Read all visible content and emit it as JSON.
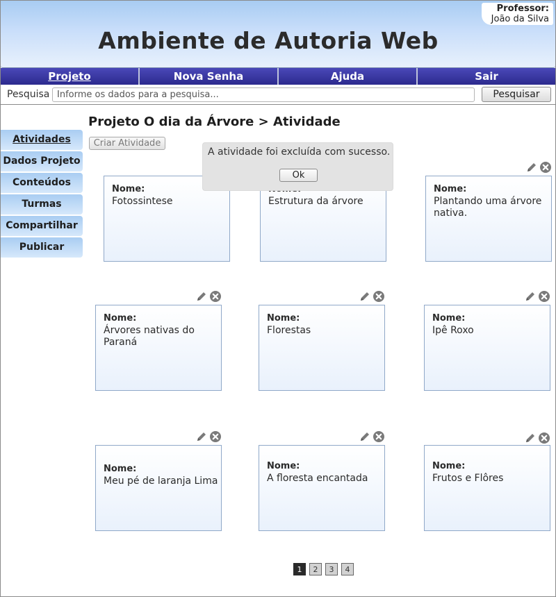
{
  "header": {
    "title": "Ambiente de Autoria Web",
    "professor_label": "Professor:",
    "professor_name": "João da Silva"
  },
  "nav": {
    "items": [
      {
        "label": "Projeto",
        "active": true
      },
      {
        "label": "Nova Senha"
      },
      {
        "label": "Ajuda"
      },
      {
        "label": "Sair"
      }
    ]
  },
  "search": {
    "label": "Pesquisa",
    "placeholder": "Informe os dados para a pesquisa...",
    "button": "Pesquisar"
  },
  "sidebar": {
    "items": [
      {
        "label": "Atividades",
        "active": true
      },
      {
        "label": "Dados Projeto"
      },
      {
        "label": "Conteúdos"
      },
      {
        "label": "Turmas"
      },
      {
        "label": "Compartilhar"
      },
      {
        "label": "Publicar"
      }
    ]
  },
  "main": {
    "breadcrumb": "Projeto O dia da Árvore > Atividade",
    "create_button": "Criar Atividade",
    "name_label": "Nome:",
    "activities": [
      "Fotossintese",
      "Estrutura da árvore",
      "Plantando uma árvore nativa.",
      "Árvores nativas do Paraná",
      "Florestas",
      "Ipê Roxo",
      "Meu pé de laranja Lima",
      "A floresta encantada",
      "Frutos e Flôres"
    ]
  },
  "pagination": {
    "pages": [
      "1",
      "2",
      "3",
      "4"
    ],
    "current": "1"
  },
  "dialog": {
    "message": "A atividade foi excluída com sucesso.",
    "ok": "Ok"
  },
  "icons": {
    "edit": "pencil-icon",
    "delete": "delete-circle-icon"
  },
  "colors": {
    "nav_bg": "#2c2a8e",
    "header_bg": "#a8ccf2",
    "sidebar_bg": "#a9cdf2",
    "card_border": "#8fa8c8"
  }
}
